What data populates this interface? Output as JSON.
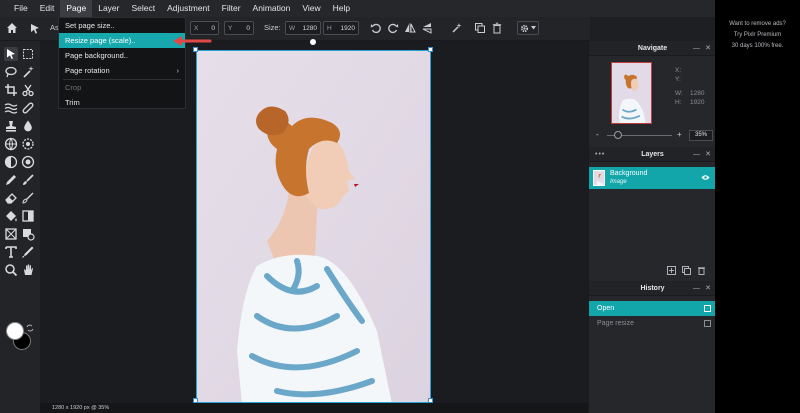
{
  "menubar": {
    "items": [
      {
        "label": "File"
      },
      {
        "label": "Edit"
      },
      {
        "label": "Page"
      },
      {
        "label": "Layer"
      },
      {
        "label": "Select"
      },
      {
        "label": "Adjustment"
      },
      {
        "label": "Filter"
      },
      {
        "label": "Animation"
      },
      {
        "label": "View"
      },
      {
        "label": "Help"
      }
    ]
  },
  "toolbar": {
    "partial_label": "As",
    "x_label": "X",
    "x_value": "0",
    "y_label": "Y",
    "y_value": "0",
    "size_label": "Size:",
    "w_label": "W",
    "w_value": "1280",
    "h_label": "H",
    "h_value": "1920"
  },
  "page_menu": {
    "items": [
      {
        "label": "Set page size.."
      },
      {
        "label": "Resize page (scale).."
      },
      {
        "label": "Page background.."
      },
      {
        "label": "Page rotation"
      },
      {
        "label": "Crop"
      },
      {
        "label": "Trim"
      }
    ],
    "submenu_chevron": "›"
  },
  "navigate": {
    "title": "Navigate",
    "x_label": "X:",
    "y_label": "Y:",
    "w_label": "W:",
    "w_value": "1280",
    "h_label": "H:",
    "h_value": "1920",
    "zoom_value": "35%",
    "zoom_out": "-",
    "zoom_in": "+"
  },
  "layers": {
    "title": "Layers",
    "items": [
      {
        "name": "Background",
        "type": "Image"
      }
    ]
  },
  "history": {
    "title": "History",
    "items": [
      {
        "label": "Open"
      },
      {
        "label": "Page resize"
      }
    ]
  },
  "status": {
    "text": "1280 x 1920 px @ 35%"
  },
  "ad": {
    "line1": "Want to remove ads?",
    "line2": "Try Pixlr Premium",
    "line3": "30 days 100% free."
  },
  "colors": {
    "accent": "#17a8ad",
    "menu_bg": "#131416",
    "panel_bg": "#26272b",
    "annotation": "#e04848"
  }
}
